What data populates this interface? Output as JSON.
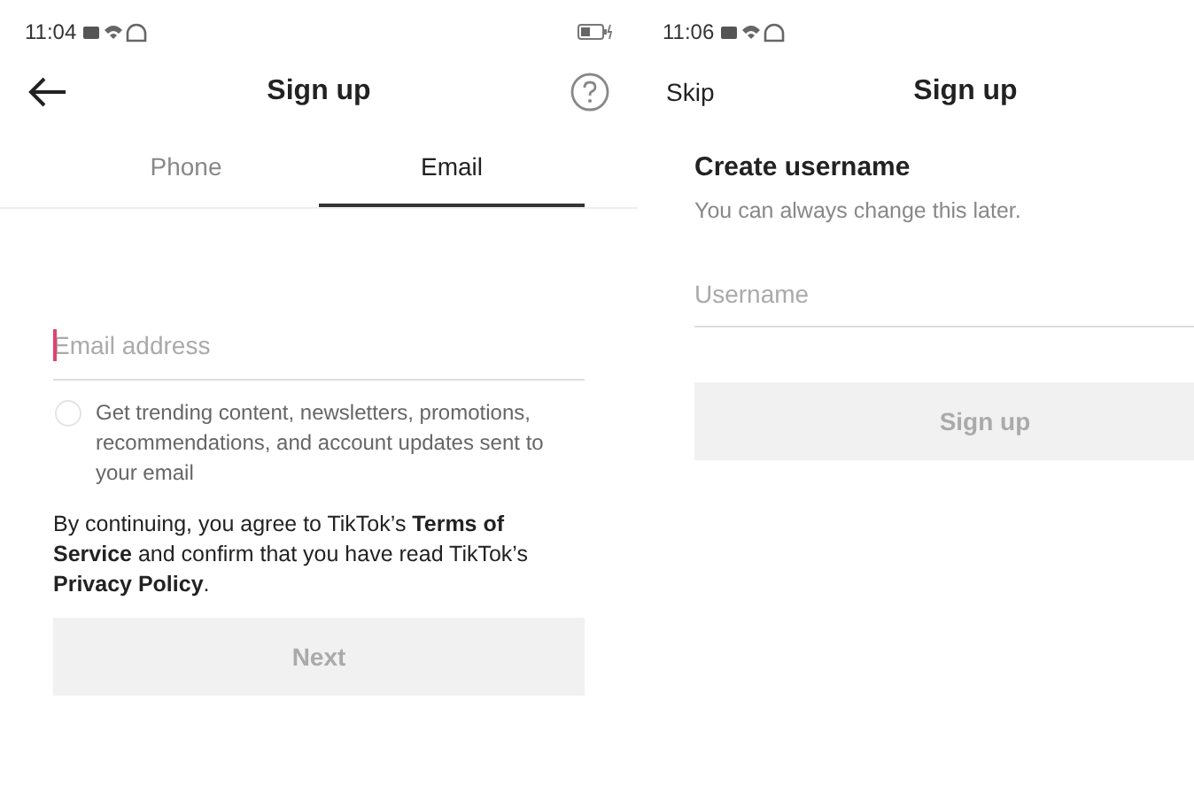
{
  "email_screen": {
    "status_bar": {
      "time": "11:04"
    },
    "header": {
      "title": "Sign up"
    },
    "tabs": [
      {
        "label": "Phone",
        "selected": false
      },
      {
        "label": "Email",
        "selected": true
      }
    ],
    "email_field": {
      "placeholder": "Email address",
      "focused": true
    },
    "marketing_opt_in": {
      "label": "Get trending content, newsletters, promotions, recommendations, and account updates sent to your email",
      "checked": false
    },
    "legal_text": "By continuing, you agree to TikTok’s **Terms of Service** and confirm that you have read TikTok’s **Privacy Policy**.",
    "next_button": {
      "label": "Next",
      "disabled": true
    }
  },
  "username_screen": {
    "status_bar": {
      "time": "11:06"
    },
    "header": {
      "skip": "Skip",
      "title": "Sign up"
    },
    "heading": "Create username",
    "subheading": "You can always change this later.",
    "username_field": {
      "placeholder": "Username"
    },
    "signup_button": {
      "label": "Sign up",
      "disabled": true
    }
  }
}
